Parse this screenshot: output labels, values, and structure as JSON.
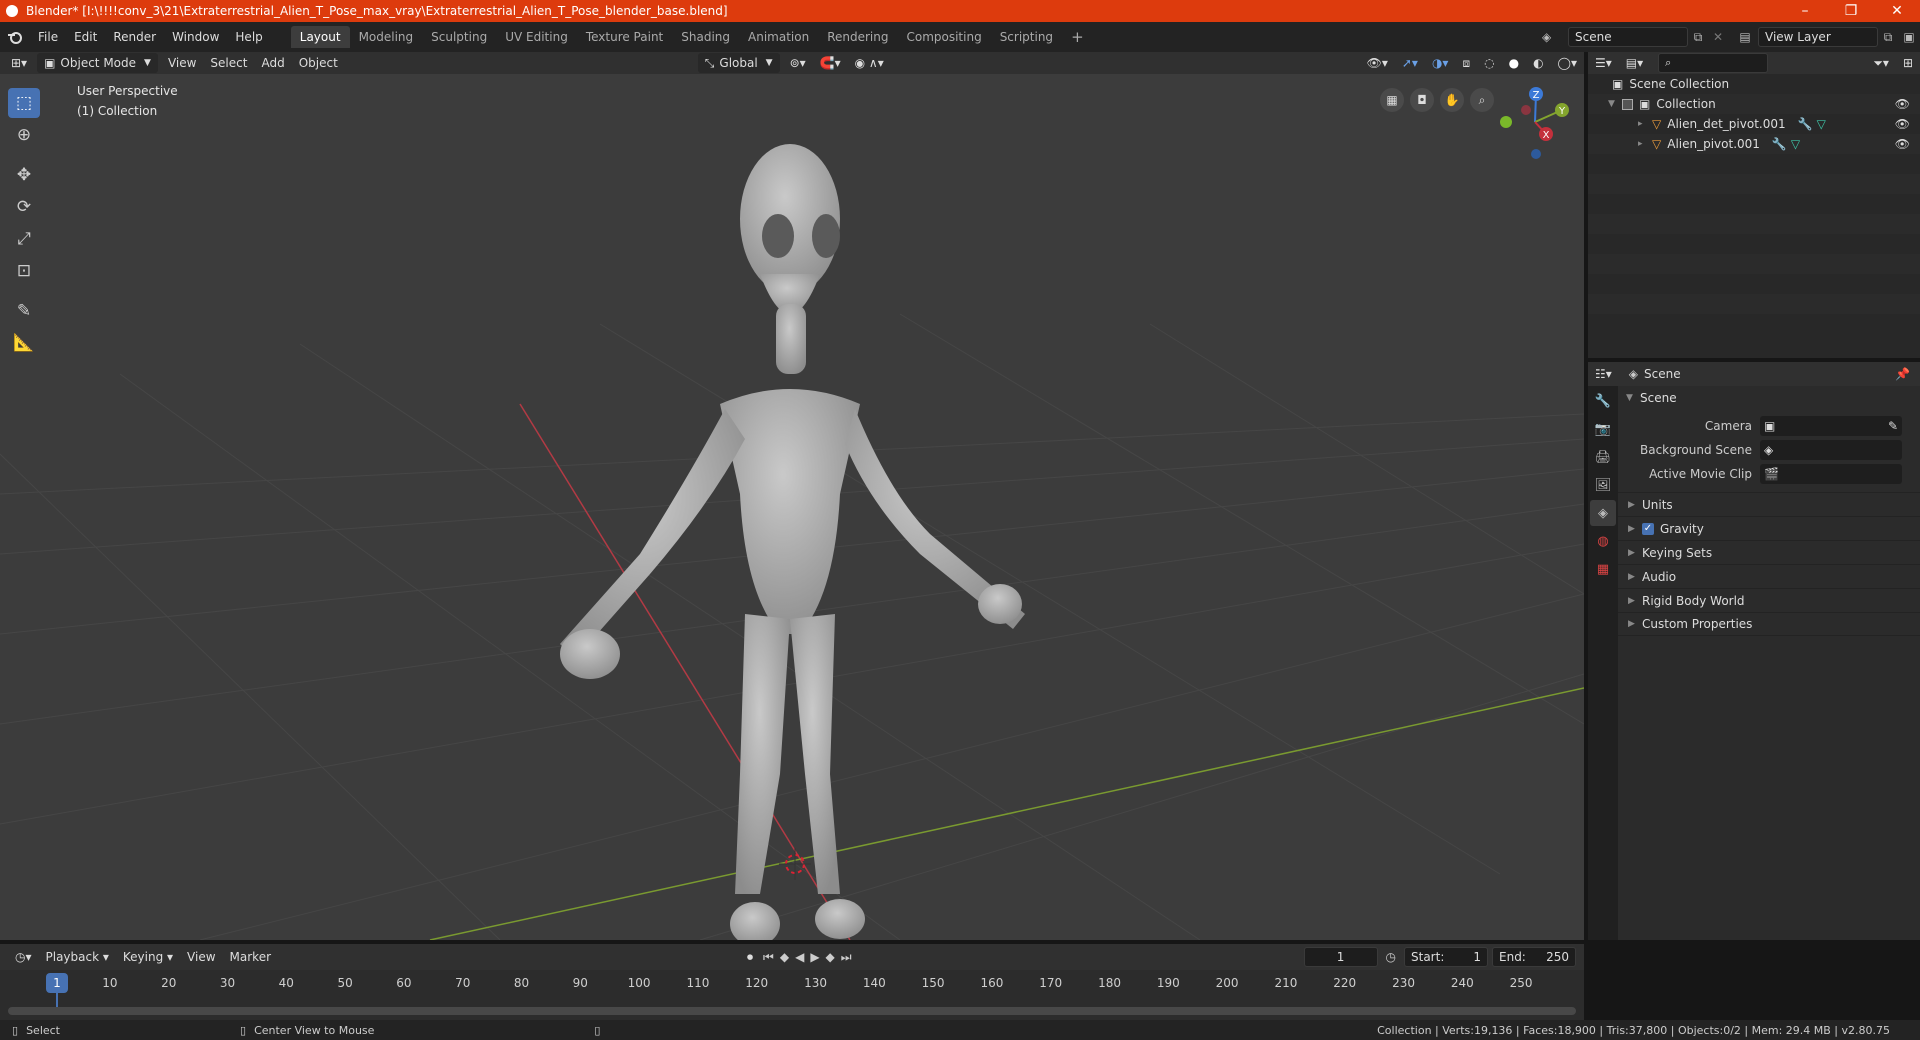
{
  "titlebar": {
    "title": "Blender* [I:\\!!!!conv_3\\21\\Extraterrestrial_Alien_T_Pose_max_vray\\Extraterrestrial_Alien_T_Pose_blender_base.blend]",
    "minimize": "–",
    "maximize": "❐",
    "close": "✕"
  },
  "menus": [
    "File",
    "Edit",
    "Render",
    "Window",
    "Help"
  ],
  "workspaces": [
    "Layout",
    "Modeling",
    "Sculpting",
    "UV Editing",
    "Texture Paint",
    "Shading",
    "Animation",
    "Rendering",
    "Compositing",
    "Scripting",
    "+"
  ],
  "scene_field": "Scene",
  "view_layer_field": "View Layer",
  "viewport": {
    "mode": "Object Mode",
    "menus": [
      "View",
      "Select",
      "Add",
      "Object"
    ],
    "transform": "Global",
    "overlay_title": "User Perspective",
    "overlay_collection": "(1) Collection",
    "gizmo": {
      "z": "Z",
      "y": "Y",
      "x": "X"
    }
  },
  "outliner": {
    "scene_collection": "Scene Collection",
    "collection": "Collection",
    "objects": [
      "Alien_det_pivot.001",
      "Alien_pivot.001"
    ]
  },
  "properties": {
    "header": "Scene",
    "panel": "Scene",
    "camera_label": "Camera",
    "bg_scene_label": "Background Scene",
    "movie_clip_label": "Active Movie Clip",
    "subpanels": [
      "Units",
      "Gravity",
      "Keying Sets",
      "Audio",
      "Rigid Body World",
      "Custom Properties"
    ],
    "gravity_checked": true
  },
  "timeline": {
    "menus": [
      "Playback",
      "Keying",
      "View",
      "Marker"
    ],
    "current_frame": "1",
    "start_label": "Start:",
    "start": "1",
    "end_label": "End:",
    "end": "250",
    "ticks": [
      "1",
      "10",
      "20",
      "30",
      "40",
      "50",
      "60",
      "70",
      "80",
      "90",
      "100",
      "110",
      "120",
      "130",
      "140",
      "150",
      "160",
      "170",
      "180",
      "190",
      "200",
      "210",
      "220",
      "230",
      "240",
      "250"
    ]
  },
  "statusbar": {
    "select": "Select",
    "center": "Center View to Mouse",
    "stats": "Collection | Verts:19,136 | Faces:18,900 | Tris:37,800 | Objects:0/2 | Mem: 29.4 MB | v2.80.75"
  },
  "colors": {
    "titlebar": "#dd3b0d",
    "accent": "#4772b3",
    "x_axis": "#c4303c",
    "y_axis": "#84a52e",
    "z_axis": "#3c7ad8"
  }
}
